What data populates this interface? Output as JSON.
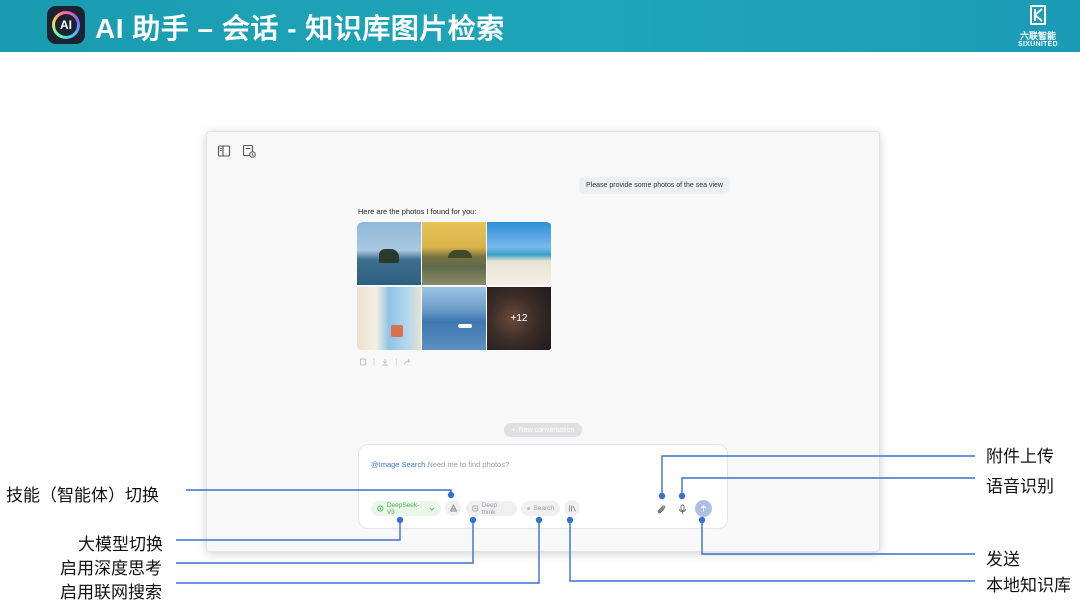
{
  "banner": {
    "title": "AI 助手 – 会话 - 知识库图片检索",
    "logo_text": "AI",
    "brand_cn": "六联智能",
    "brand_en": "SIXUNITED"
  },
  "chat": {
    "user_message": "Please provide some photos of the sea view",
    "ai_message": "Here are the photos I found for you:",
    "more_photos_label": "+12",
    "action_sep": "|",
    "new_conversation_label": "New conversation"
  },
  "input": {
    "skill_label": "@Image Search",
    "placeholder": "Need me to find photos?",
    "model_label": "DeepSeek-V3",
    "deep_think_label": "Deep think",
    "search_label": "Search"
  },
  "annotations": {
    "skill_switch": "技能（智能体）切换",
    "model_switch": "大模型切换",
    "deep_think": "启用深度思考",
    "web_search": "启用联网搜索",
    "attachment": "附件上传",
    "voice": "语音识别",
    "send": "发送",
    "knowledge_base": "本地知识库"
  },
  "colors": {
    "banner": "#1fa6b9",
    "accent": "#3a78e0",
    "connector": "#3a6fd0",
    "send": "#aebfe6"
  }
}
